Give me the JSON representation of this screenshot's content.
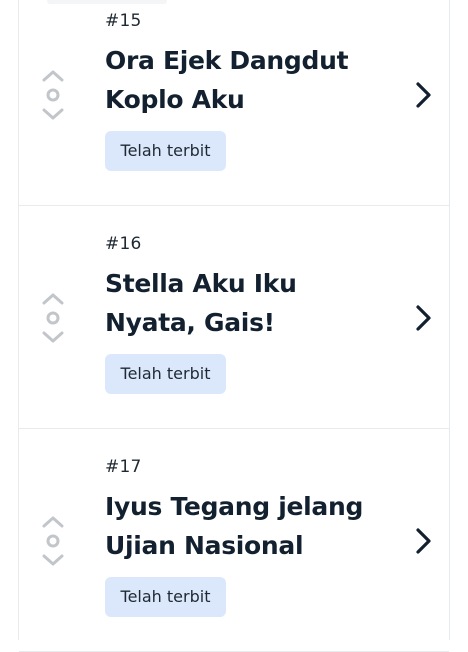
{
  "chapters": [
    {
      "number": "#15",
      "title": "Ora Ejek Dangdut Koplo Aku",
      "status": "Telah terbit"
    },
    {
      "number": "#16",
      "title": "Stella Aku Iku Nyata, Gais!",
      "status": "Telah terbit"
    },
    {
      "number": "#17",
      "title": "Iyus Tegang jelang Ujian Nasional",
      "status": "Telah terbit"
    }
  ],
  "icons": {
    "reorder": "reorder-handle-icon",
    "open": "chevron-right-icon"
  },
  "colors": {
    "badge_bg": "#dbe8fb",
    "title_text": "#12202f",
    "divider": "#e8ebee",
    "handle": "#c2c6ca"
  }
}
